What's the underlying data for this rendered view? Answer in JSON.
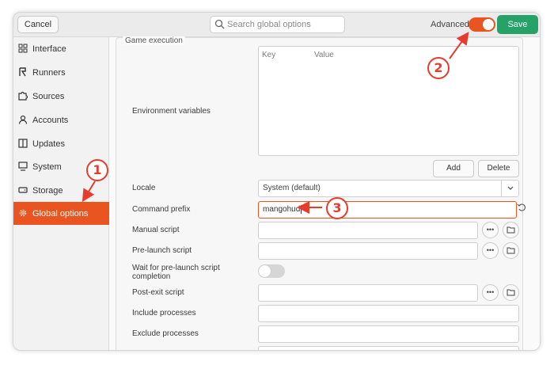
{
  "header": {
    "cancel_label": "Cancel",
    "search_placeholder": "Search global options",
    "advanced_label": "Advanced",
    "save_label": "Save"
  },
  "sidebar": {
    "items": [
      {
        "label": "Interface",
        "icon": "grid-icon"
      },
      {
        "label": "Runners",
        "icon": "runner-icon"
      },
      {
        "label": "Sources",
        "icon": "puzzle-icon"
      },
      {
        "label": "Accounts",
        "icon": "person-icon"
      },
      {
        "label": "Updates",
        "icon": "book-icon"
      },
      {
        "label": "System",
        "icon": "monitor-icon"
      },
      {
        "label": "Storage",
        "icon": "drive-icon"
      },
      {
        "label": "Global options",
        "icon": "gear-icon",
        "active": true
      }
    ]
  },
  "section": {
    "title": "Game execution",
    "env_label": "Environment variables",
    "env_col_key": "Key",
    "env_col_value": "Value",
    "add_label": "Add",
    "delete_label": "Delete",
    "locale_label": "Locale",
    "locale_value": "System (default)",
    "command_prefix_label": "Command prefix",
    "command_prefix_value": "mangohud",
    "manual_script_label": "Manual script",
    "pre_launch_label": "Pre-launch script",
    "wait_label_1": "Wait for pre-launch script",
    "wait_label_2": "completion",
    "post_exit_label": "Post-exit script",
    "include_label": "Include processes",
    "exclude_label": "Exclude processes",
    "browse_glyph": "•••"
  },
  "annotations": [
    "1",
    "2",
    "3"
  ],
  "colors": {
    "accent": "#e95420",
    "save": "#26a269",
    "annotation": "#e53c2e"
  }
}
